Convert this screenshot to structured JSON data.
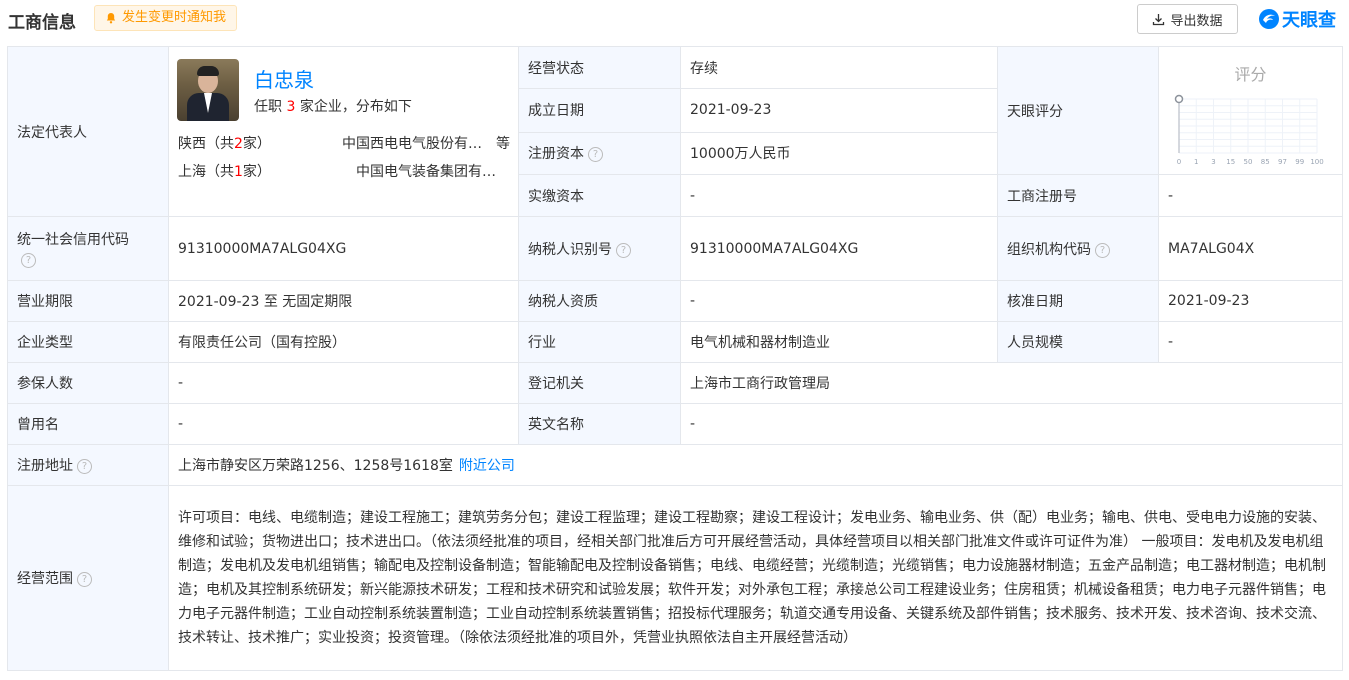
{
  "header": {
    "title": "工商信息",
    "notify_label": "发生变更时通知我",
    "export_label": "导出数据",
    "brand": "天眼查"
  },
  "legal": {
    "label": "法定代表人",
    "name": "白忠泉",
    "sub_prefix": "任职 ",
    "sub_count": "3",
    "sub_suffix": " 家企业，分布如下",
    "regions": [
      {
        "prefix": "陕西（共",
        "count": "2",
        "suffix": "家）",
        "company": "中国西电电气股份有…",
        "etc": "等"
      },
      {
        "prefix": "上海（共",
        "count": "1",
        "suffix": "家）",
        "company": "中国电气装备集团有…",
        "etc": ""
      }
    ]
  },
  "fields": {
    "status_label": "经营状态",
    "status": "存续",
    "founded_label": "成立日期",
    "founded": "2021-09-23",
    "capital_label": "注册资本",
    "capital": "10000万人民币",
    "paid_label": "实缴资本",
    "paid": "-",
    "score_label": "天眼评分",
    "regno_label": "工商注册号",
    "regno": "-",
    "credit_label": "统一社会信用代码",
    "credit": "91310000MA7ALG04XG",
    "taxid_label": "纳税人识别号",
    "taxid": "91310000MA7ALG04XG",
    "org_label": "组织机构代码",
    "org": "MA7ALG04X",
    "term_label": "营业期限",
    "term_start": "2021-09-23",
    "term_sep": "至",
    "term_end": "无固定期限",
    "taxq_label": "纳税人资质",
    "taxq": "-",
    "approve_label": "核准日期",
    "approve": "2021-09-23",
    "type_label": "企业类型",
    "type": "有限责任公司（国有控股）",
    "industry_label": "行业",
    "industry": "电气机械和器材制造业",
    "staff_label": "人员规模",
    "staff": "-",
    "insured_label": "参保人数",
    "insured": "-",
    "authority_label": "登记机关",
    "authority": "上海市工商行政管理局",
    "former_label": "曾用名",
    "former": "-",
    "english_label": "英文名称",
    "english": "-",
    "address_label": "注册地址",
    "address": "上海市静安区万荣路1256、1258号1618室",
    "nearby": "附近公司",
    "scope_label": "经营范围",
    "scope": "许可项目：电线、电缆制造；建设工程施工；建筑劳务分包；建设工程监理；建设工程勘察；建设工程设计；发电业务、输电业务、供（配）电业务；输电、供电、受电电力设施的安装、维修和试验；货物进出口；技术进出口。（依法须经批准的项目，经相关部门批准后方可开展经营活动，具体经营项目以相关部门批准文件或许可证件为准） 一般项目：发电机及发电机组制造；发电机及发电机组销售；输配电及控制设备制造；智能输配电及控制设备销售；电线、电缆经营；光缆制造；光缆销售；电力设施器材制造；五金产品制造；电工器材制造；电机制造；电机及其控制系统研发；新兴能源技术研发；工程和技术研究和试验发展；软件开发；对外承包工程；承接总公司工程建设业务；住房租赁；机械设备租赁；电力电子元器件销售；电力电子元器件制造；工业自动控制系统装置制造；工业自动控制系统装置销售；招投标代理服务；轨道交通专用设备、关键系统及部件销售；技术服务、技术开发、技术咨询、技术交流、技术转让、技术推广；实业投资；投资管理。（除依法须经批准的项目外，凭营业执照依法自主开展经营活动）"
  },
  "score_chart": {
    "title": "评分",
    "ticks": [
      "0",
      "1",
      "3",
      "15",
      "50",
      "85",
      "97",
      "99",
      "100"
    ],
    "value": 0
  },
  "help_glyph": "?",
  "colors": {
    "accent": "#0084ff",
    "label_bg": "#f4f8ff",
    "warn": "#ff9900",
    "count": "#ff0000"
  }
}
